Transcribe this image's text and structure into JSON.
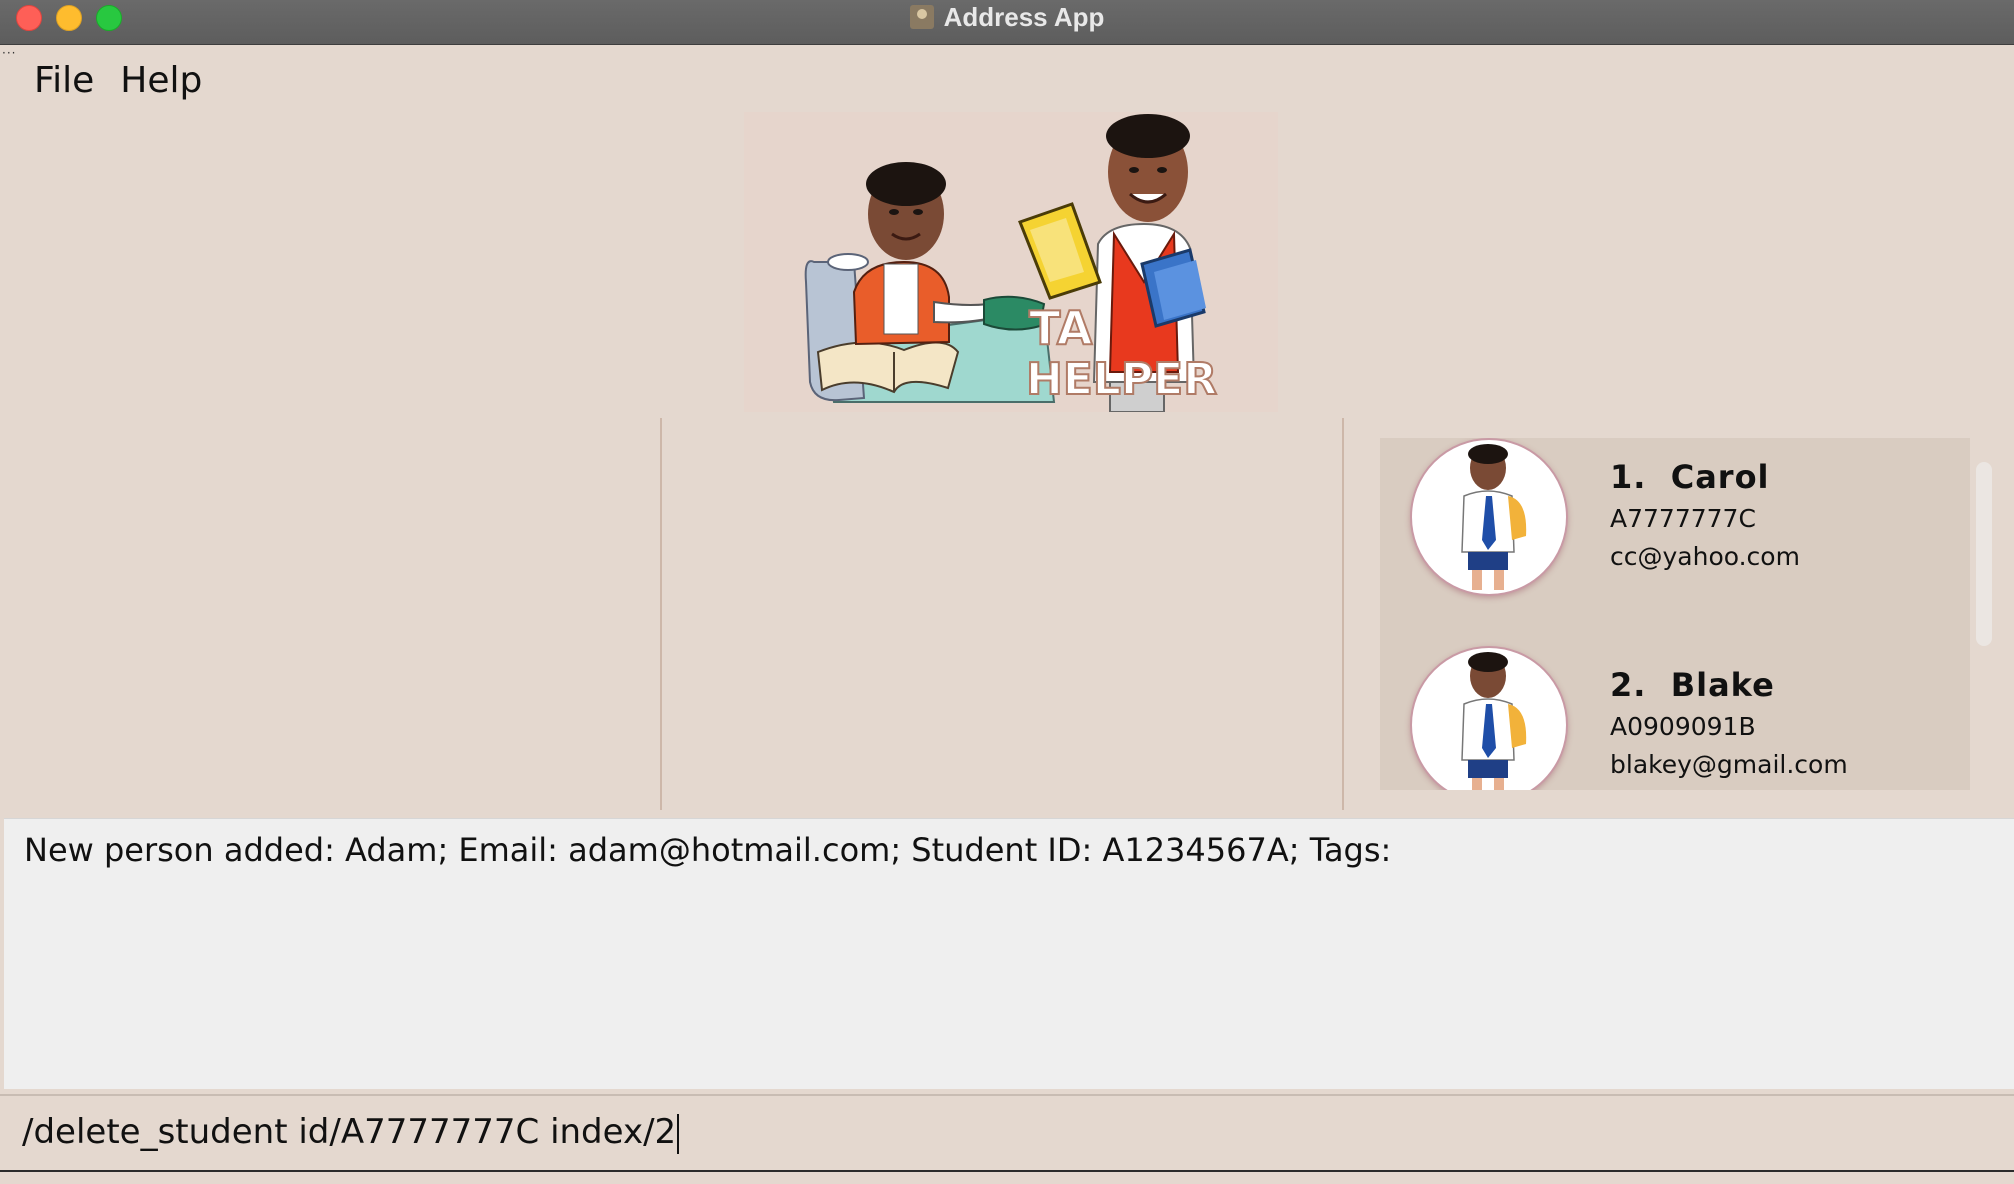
{
  "window": {
    "title": "Address App"
  },
  "menu": {
    "items": [
      "File",
      "Help"
    ]
  },
  "banner": {
    "logo_text_line1": "TA",
    "logo_text_line2": "HELPER"
  },
  "students": [
    {
      "index": "1.",
      "name": "Carol",
      "student_id": "A7777777C",
      "email": "cc@yahoo.com"
    },
    {
      "index": "2.",
      "name": "Blake",
      "student_id": "A0909091B",
      "email": "blakey@gmail.com"
    }
  ],
  "result": {
    "message": "New person added: Adam; Email: adam@hotmail.com; Student ID: A1234567A; Tags:"
  },
  "command": {
    "value": "/delete_student id/A7777777C index/2"
  },
  "colors": {
    "background": "#e4d8cf",
    "result_bg": "#efefef",
    "list_bg": "#d9ccc1"
  }
}
